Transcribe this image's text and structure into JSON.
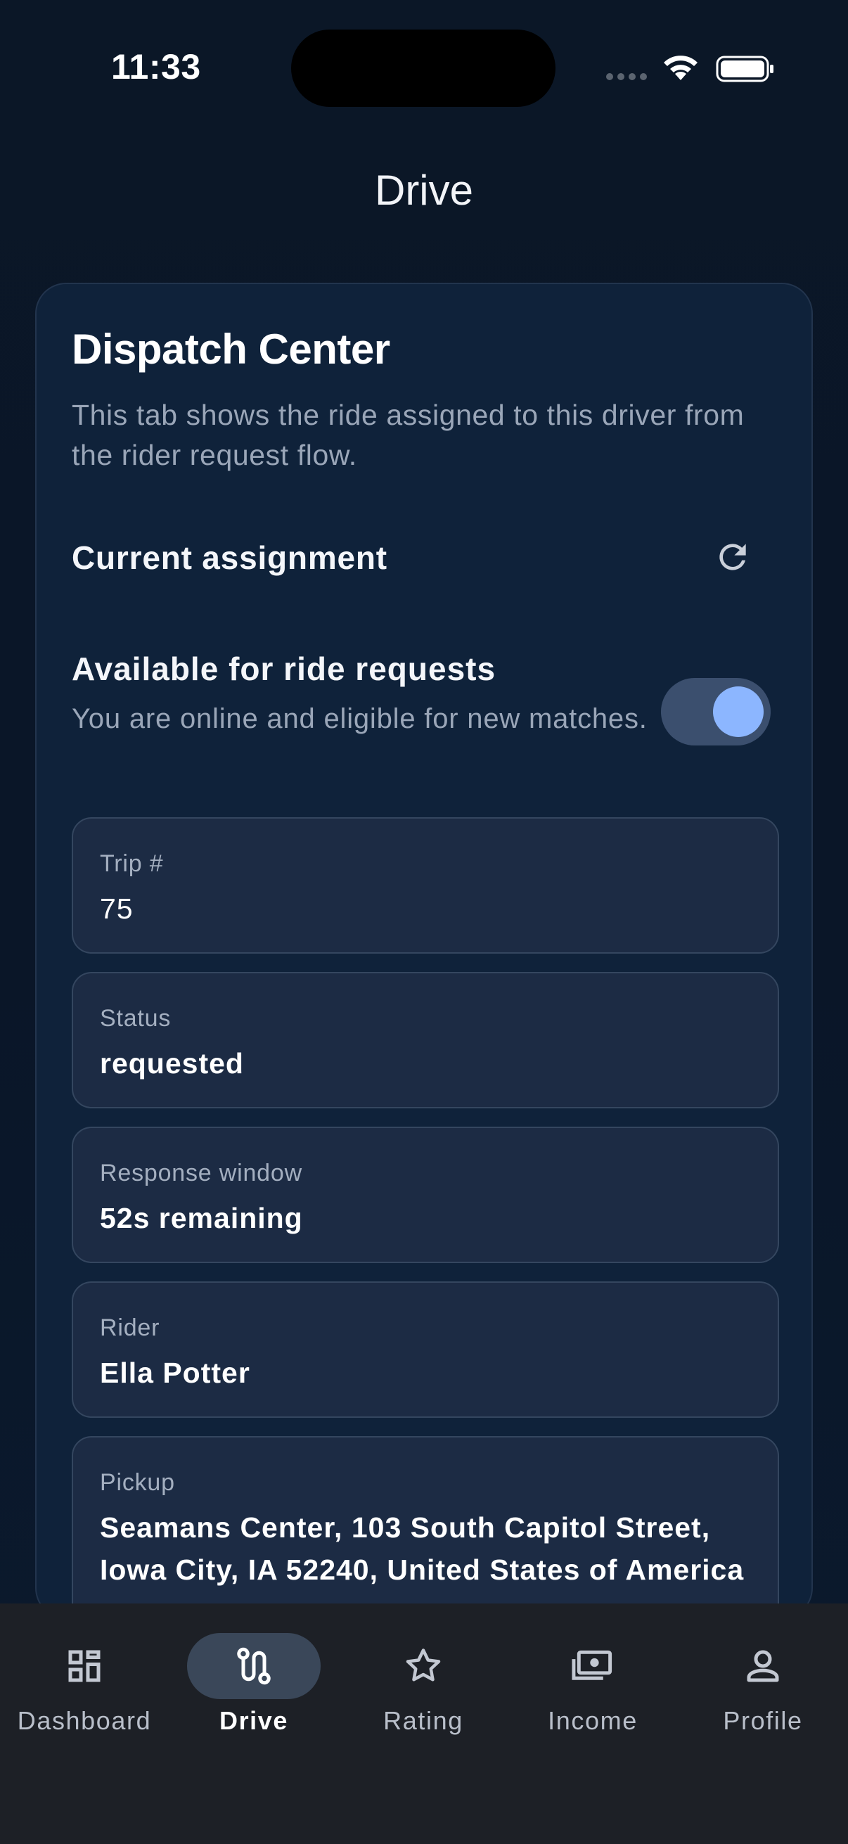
{
  "status_bar": {
    "time": "11:33"
  },
  "header": {
    "title": "Drive"
  },
  "dispatch": {
    "title": "Dispatch Center",
    "description": "This tab shows the ride assigned to this driver from the rider request flow.",
    "current_assignment_label": "Current assignment",
    "availability": {
      "label": "Available for ride requests",
      "description": "You are online and eligible for new matches.",
      "enabled": true
    },
    "fields": [
      {
        "label": "Trip #",
        "value": "75"
      },
      {
        "label": "Status",
        "value": "requested"
      },
      {
        "label": "Response window",
        "value": "52s remaining"
      },
      {
        "label": "Rider",
        "value": "Ella Potter"
      },
      {
        "label": "Pickup",
        "value": "Seamans Center, 103 South Capitol Street, Iowa City, IA 52240, United States of America"
      }
    ]
  },
  "nav": {
    "items": [
      {
        "label": "Dashboard",
        "icon": "dashboard-icon"
      },
      {
        "label": "Drive",
        "icon": "route-icon",
        "active": true
      },
      {
        "label": "Rating",
        "icon": "star-icon"
      },
      {
        "label": "Income",
        "icon": "payments-icon"
      },
      {
        "label": "Profile",
        "icon": "person-icon"
      }
    ]
  },
  "colors": {
    "background": "#0a1626",
    "card": "#0f223a",
    "field": "#1c2b44",
    "accent": "#8cb6ff",
    "nav_background": "#1d2026"
  }
}
